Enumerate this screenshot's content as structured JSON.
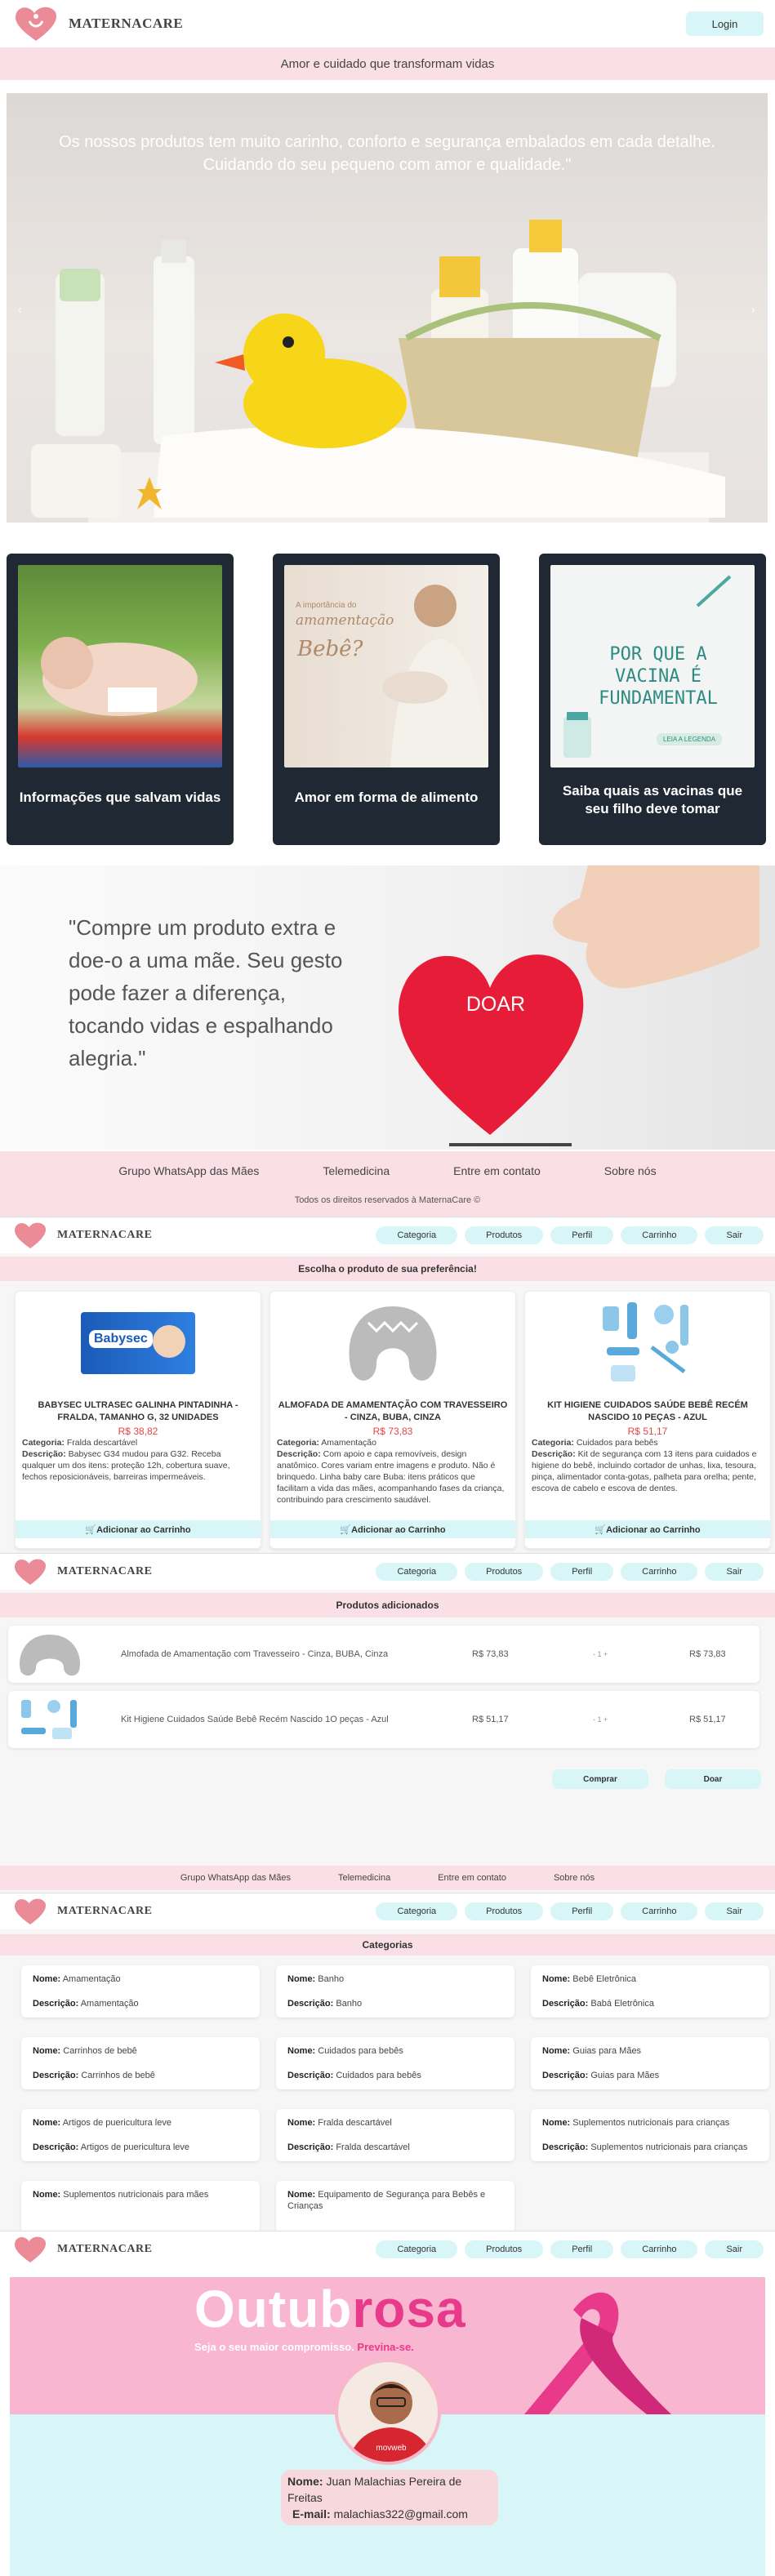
{
  "brand": {
    "name": "MATERNACARE",
    "heart_color": "#e8838f"
  },
  "home": {
    "login_label": "Login",
    "tagline": "Amor e cuidado que transformam vidas",
    "hero_quote": "Os nossos produtos tem muito carinho, conforto e segurança embalados em cada detalhe. Cuidando do seu pequeno com amor e qualidade.\"",
    "cards": [
      {
        "caption": "Informações que salvam vidas"
      },
      {
        "caption": "Amor em forma de alimento",
        "img_text_small": "A importância do",
        "img_text_big": "amamentação",
        "img_text_q": "Bebê?"
      },
      {
        "caption": "Saiba quais as vacinas que seu filho deve tomar",
        "img_text": "POR QUE A VACINA É FUNDAMENTAL",
        "img_badge": "LEIA A LEGENDA"
      }
    ],
    "donate_quote": "\"Compre um produto extra e doe-o a uma mãe. Seu gesto pode fazer a diferença, tocando vidas e espalhando alegria.\"",
    "donate_label": "DOAR",
    "footer_links": [
      "Grupo WhatsApp das Mães",
      "Telemedicina",
      "Entre em contato",
      "Sobre nós"
    ],
    "copyright": "Todos os direitos reservados à MaternaCare ©"
  },
  "nav": [
    "Categoria",
    "Produtos",
    "Perfil",
    "Carrinho",
    "Sair"
  ],
  "products_page": {
    "title": "Escolha o produto de sua preferência!",
    "items": [
      {
        "name": "BABYSEC ULTRASEC GALINHA PINTADINHA - FRALDA, TAMANHO G, 32 UNIDADES",
        "price": "R$ 38,82",
        "category": "Fralda descartável",
        "description": "Babysec G34 mudou para G32. Receba qualquer um dos itens: proteção 12h, cobertura suave, fechos reposicionáveis, barreiras impermeáveis.",
        "brand_label": "Babysec"
      },
      {
        "name": "ALMOFADA DE AMAMENTAÇÃO COM TRAVESSEIRO - CINZA, BUBA, CINZA",
        "price": "R$ 73,83",
        "category": "Amamentação",
        "description": "Com apoio e capa removíveis, design anatômico. Cores variam entre imagens e produto. Não é brinquedo. Linha baby care Buba: itens práticos que facilitam a vida das mães, acompanhando fases da criança, contribuindo para crescimento saudável."
      },
      {
        "name": "KIT HIGIENE CUIDADOS SAÚDE BEBÊ RECÉM NASCIDO 10 PEÇAS - AZUL",
        "price": "R$ 51,17",
        "category": "Cuidados para bebês",
        "description": "Kit de segurança com 13 itens para cuidados e higiene do bebê, incluindo cortador de unhas, lixa, tesoura, pinça, alimentador conta-gotas, palheta para orelha; pente, escova de cabelo e escova de dentes."
      }
    ],
    "category_label": "Categoria:",
    "description_label": "Descrição:",
    "add_label": "🛒Adicionar ao Carrinho"
  },
  "cart_page": {
    "title": "Produtos adicionados",
    "rows": [
      {
        "name": "Almofada de Amamentação com Travesseiro - Cinza, BUBA, Cinza",
        "price": "R$ 73,83",
        "qty": "- 1 +",
        "total": "R$ 73,83"
      },
      {
        "name": "Kit Higiene Cuidados Saúde Bebê Recém Nascido 1O peças - Azul",
        "price": "R$ 51,17",
        "qty": "- 1 +",
        "total": "R$ 51,17"
      }
    ],
    "buy_label": "Comprar",
    "donate_label": "Doar"
  },
  "categories_page": {
    "title": "Categorias",
    "name_label": "Nome:",
    "desc_label": "Descrição:",
    "items": [
      {
        "name": "Amamentação",
        "desc": "Amamentação"
      },
      {
        "name": "Banho",
        "desc": "Banho"
      },
      {
        "name": "Bebê Eletrônica",
        "desc": "Babá Eletrônica"
      },
      {
        "name": "Carrinhos de bebê",
        "desc": "Carrinhos de bebê"
      },
      {
        "name": "Cuidados para bebês",
        "desc": "Cuidados para bebês"
      },
      {
        "name": "Guias para Mães",
        "desc": "Guias para Mães"
      },
      {
        "name": "Artigos de puericultura leve",
        "desc": "Artigos de puericultura leve"
      },
      {
        "name": "Fralda descartável",
        "desc": "Fralda descartável"
      },
      {
        "name": "Suplementos nutricionais para crianças",
        "desc": "Suplementos nutricionais para crianças"
      },
      {
        "name": "Suplementos nutricionais para mães",
        "desc": ""
      },
      {
        "name": "Equipamento de Segurança para Bebês e Crianças",
        "desc": ""
      }
    ]
  },
  "profile_page": {
    "banner_title_a": "Outub",
    "banner_title_b": "rosa",
    "banner_sub_a": "Seja o seu maior compromisso.",
    "banner_sub_b": "Previna-se.",
    "name_label": "Nome:",
    "name": "Juan Malachias Pereira de Freitas",
    "email_label": "E-mail:",
    "email": "malachias322@gmail.com",
    "shirt_text": "movweb"
  }
}
